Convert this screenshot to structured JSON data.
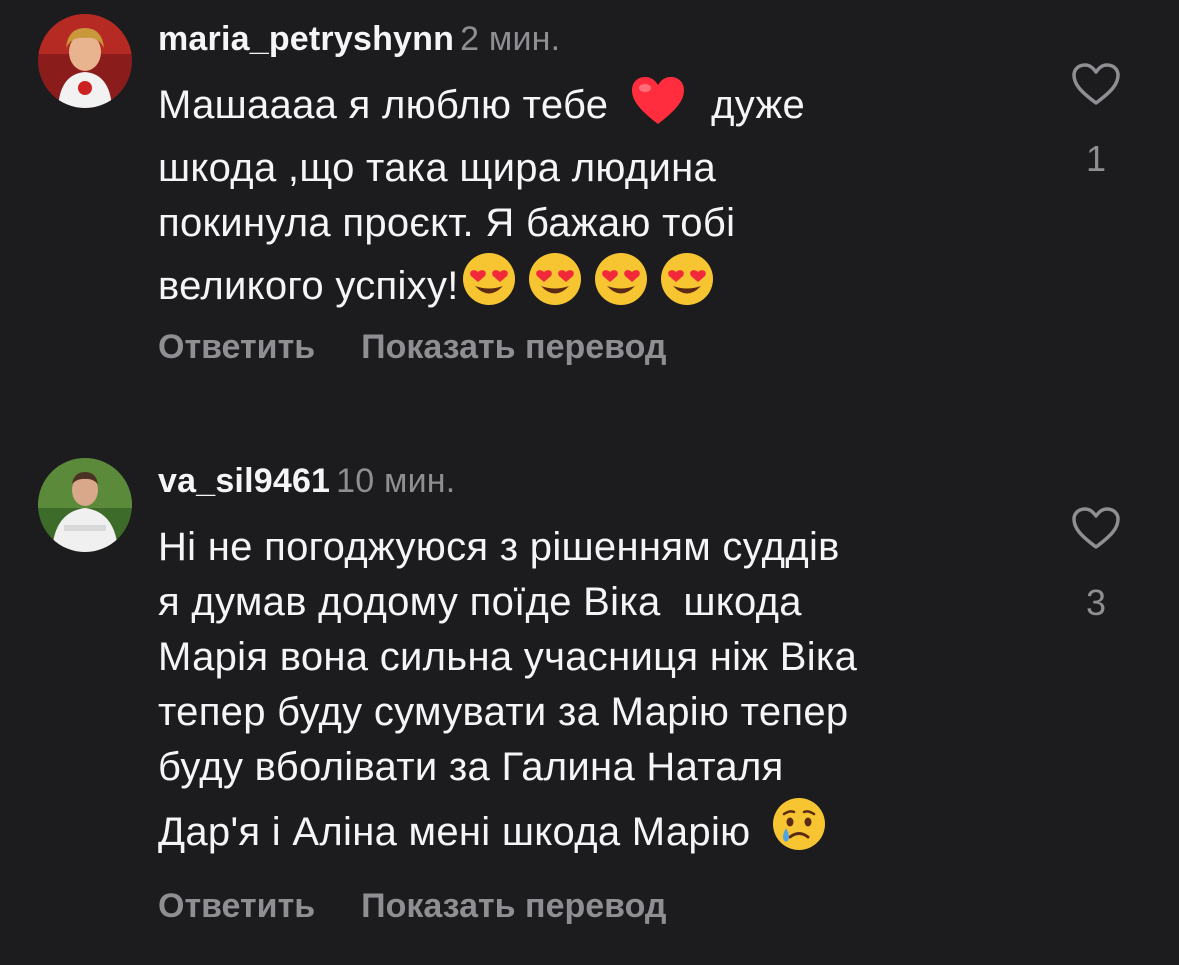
{
  "comments": [
    {
      "username": "maria_petryshynn",
      "time": "2 мин.",
      "lines": [
        "Машаааа я люблю тебе",
        "дуже",
        "шкода ,що така щира людина",
        "покинула проєкт. Я бажаю тобі",
        "великого успіху!"
      ],
      "like_count": "1",
      "reply_label": "Ответить",
      "translate_label": "Показать перевод",
      "emojis": [
        "red-heart",
        "smiling-face-with-heart-eyes"
      ]
    },
    {
      "username": "va_sil9461",
      "time": "10 мин.",
      "lines": [
        "Ні не погоджуюся з рішенням суддів",
        "я думав додому поїде Віка  шкода",
        "Марія вона сильна учасниця ніж Віка",
        "тепер буду сумувати за Марію тепер",
        "буду вболівати за Галина Наталя",
        "Дар'я і Аліна мені шкода Марію"
      ],
      "like_count": "3",
      "reply_label": "Ответить",
      "translate_label": "Показать перевод",
      "emojis": [
        "crying-face"
      ]
    }
  ],
  "colors": {
    "background": "#1c1c1e",
    "primary_text": "#f5f5f7",
    "secondary_text": "#8e8e93",
    "heart": "#ff2d3d",
    "emoji_yellow": "#f7c531"
  }
}
